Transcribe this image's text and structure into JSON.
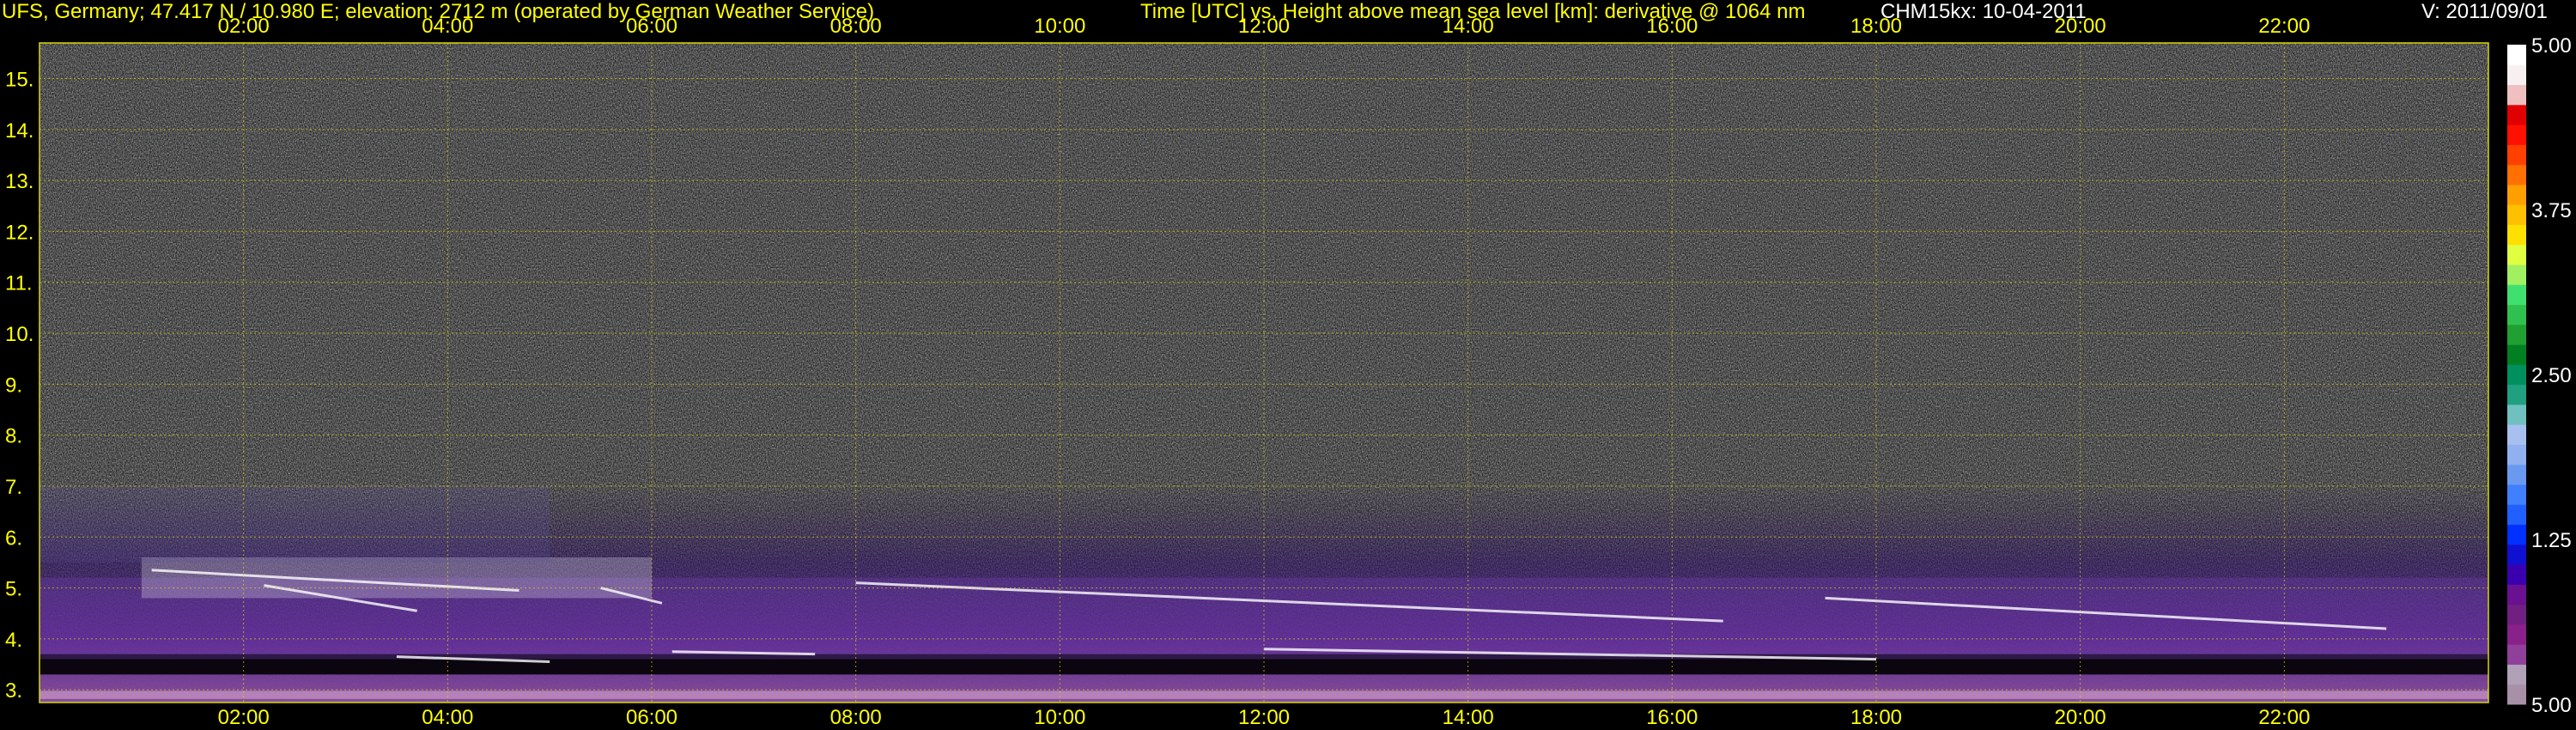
{
  "header": {
    "site": "UFS, Germany; 47.417 N / 10.980 E; elevation: 2712 m  (operated by German Weather Service)",
    "axes_desc": "Time [UTC] vs. Height above mean sea level [km]: derivative @ 1064 nm",
    "instrument_date": "CHM15kx: 10-04-2011",
    "version": "V: 2011/09/01"
  },
  "colors": {
    "title": "#ffff00",
    "axis_labels": "#ffff00",
    "grid": "#d8d800",
    "background": "#000000"
  },
  "chart_data": {
    "type": "heatmap",
    "xlabel": "Time [UTC]",
    "ylabel": "Height above mean sea level [km]",
    "x_tick_labels": [
      "02:00",
      "04:00",
      "06:00",
      "08:00",
      "10:00",
      "12:00",
      "14:00",
      "16:00",
      "18:00",
      "20:00",
      "22:00"
    ],
    "x_tick_hours": [
      2,
      4,
      6,
      8,
      10,
      12,
      14,
      16,
      18,
      20,
      22
    ],
    "xlim": [
      0,
      24
    ],
    "y_ticks": [
      3,
      4,
      5,
      6,
      7,
      8,
      9,
      10,
      11,
      12,
      13,
      14,
      15
    ],
    "y_tick_labels": [
      "3.",
      "4.",
      "5.",
      "6.",
      "7.",
      "8.",
      "9.",
      "10.",
      "11.",
      "12.",
      "13.",
      "14.",
      "15."
    ],
    "ylim": [
      2.75,
      15.7
    ],
    "grid": true,
    "colorbar": {
      "tick_labels": [
        "5.00",
        "3.75",
        "2.50",
        "1.25",
        "5.00"
      ],
      "tick_positions": [
        1.0,
        0.75,
        0.5,
        0.25,
        0.0
      ],
      "colors": [
        "#a890a8",
        "#b0a0b8",
        "#90409a",
        "#8a208a",
        "#702080",
        "#6a1090",
        "#3a00b0",
        "#1010d0",
        "#0030ff",
        "#2060ff",
        "#4080ff",
        "#6a9af0",
        "#90b0f0",
        "#a8c0f0",
        "#70c0c0",
        "#20a080",
        "#009060",
        "#008020",
        "#20a030",
        "#30c050",
        "#40e070",
        "#a0f060",
        "#e0ff40",
        "#ffe000",
        "#ffc000",
        "#ffa000",
        "#ff7000",
        "#ff4000",
        "#ff1000",
        "#e00000",
        "#f0c0c0",
        "#f8f0f0",
        "#ffffff"
      ]
    },
    "features": [
      {
        "name": "surface",
        "time_range": [
          0,
          24
        ],
        "height_km": 2.9
      },
      {
        "name": "boundary layer top",
        "time_range": [
          0,
          24
        ],
        "height_km": [
          3.3,
          3.7
        ]
      },
      {
        "name": "aerosol layer",
        "time_range": [
          0,
          24
        ],
        "height_km": [
          3.6,
          5.2
        ]
      },
      {
        "name": "layer",
        "time_range": [
          1,
          6
        ],
        "height_km": [
          4.8,
          5.6
        ]
      },
      {
        "name": "upper aerosol",
        "time_range": [
          0,
          5
        ],
        "height_km": [
          5.5,
          7.0
        ]
      }
    ]
  }
}
